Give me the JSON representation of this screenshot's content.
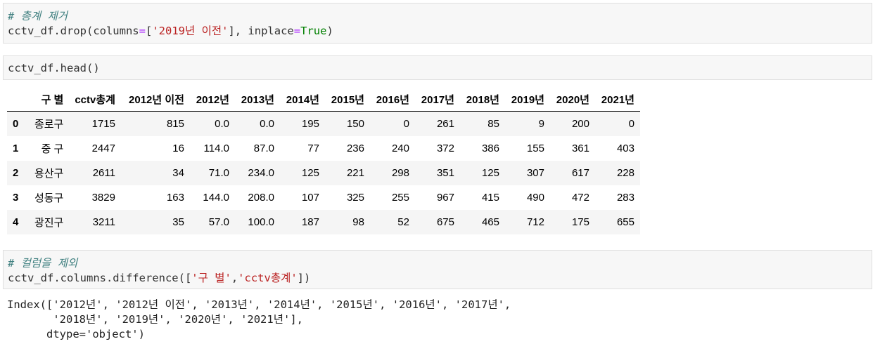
{
  "cells": [
    {
      "comment": "# 총계 제거",
      "code": {
        "prefix": "cctv_df.drop(columns",
        "eq": "=",
        "bracket_open": "[",
        "string": "'2019년 이전'",
        "middle": "], inplace",
        "eq2": "=",
        "keyword": "True",
        "suffix": ")"
      }
    },
    {
      "code_text": "cctv_df.head()"
    },
    {
      "comment": "# 컬럼을 제외",
      "code": {
        "prefix": "cctv_df.columns.difference([",
        "string1": "'구 별'",
        "sep": ",",
        "string2": "'cctv총계'",
        "suffix": "])"
      }
    }
  ],
  "table": {
    "columns": [
      "",
      "구 별",
      "cctv총계",
      "2012년 이전",
      "2012년",
      "2013년",
      "2014년",
      "2015년",
      "2016년",
      "2017년",
      "2018년",
      "2019년",
      "2020년",
      "2021년"
    ],
    "rows": [
      [
        "0",
        "종로구",
        "1715",
        "815",
        "0.0",
        "0.0",
        "195",
        "150",
        "0",
        "261",
        "85",
        "9",
        "200",
        "0"
      ],
      [
        "1",
        "중 구",
        "2447",
        "16",
        "114.0",
        "87.0",
        "77",
        "236",
        "240",
        "372",
        "386",
        "155",
        "361",
        "403"
      ],
      [
        "2",
        "용산구",
        "2611",
        "34",
        "71.0",
        "234.0",
        "125",
        "221",
        "298",
        "351",
        "125",
        "307",
        "617",
        "228"
      ],
      [
        "3",
        "성동구",
        "3829",
        "163",
        "144.0",
        "208.0",
        "107",
        "325",
        "255",
        "967",
        "415",
        "490",
        "472",
        "283"
      ],
      [
        "4",
        "광진구",
        "3211",
        "35",
        "57.0",
        "100.0",
        "187",
        "98",
        "52",
        "675",
        "465",
        "712",
        "175",
        "655"
      ]
    ]
  },
  "output": {
    "line1": "Index(['2012년', '2012년 이전', '2013년', '2014년', '2015년', '2016년', '2017년',",
    "line2": "       '2018년', '2019년', '2020년', '2021년'],",
    "line3": "      dtype='object')"
  }
}
